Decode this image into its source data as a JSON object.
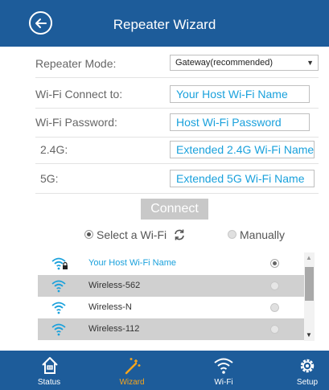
{
  "header": {
    "title": "Repeater Wizard"
  },
  "form": {
    "mode_label": "Repeater Mode:",
    "mode_value": "Gateway(recommended)",
    "connect_label": "Wi-Fi Connect to:",
    "connect_value": "Your Host Wi-Fi Name",
    "password_label": "Wi-Fi Password:",
    "password_value": "Host Wi-Fi Password",
    "g24_label": "2.4G:",
    "g24_value": "Extended 2.4G Wi-Fi Name",
    "g5_label": "5G:",
    "g5_value": "Extended 5G Wi-Fi Name"
  },
  "connect_button": "Connect",
  "options": {
    "select_label": "Select a Wi-Fi",
    "manual_label": "Manually"
  },
  "networks": [
    {
      "name": "Your Host Wi-Fi Name",
      "selected": true,
      "locked": true
    },
    {
      "name": "Wireless-562",
      "selected": false,
      "locked": false
    },
    {
      "name": "Wireless-N",
      "selected": false,
      "locked": false
    },
    {
      "name": "Wireless-112",
      "selected": false,
      "locked": false
    }
  ],
  "footer": {
    "tabs": [
      {
        "label": "Status",
        "icon": "home-icon",
        "active": false
      },
      {
        "label": "Wizard",
        "icon": "magic-wand-icon",
        "active": true
      },
      {
        "label": "Wi-Fi",
        "icon": "wifi-icon",
        "active": false
      },
      {
        "label": "Setup",
        "icon": "gear-icon",
        "active": false
      }
    ]
  },
  "colors": {
    "header_bg": "#1d5c9a",
    "accent_blue": "#1aa1dc",
    "active_tab": "#f7a51c"
  }
}
